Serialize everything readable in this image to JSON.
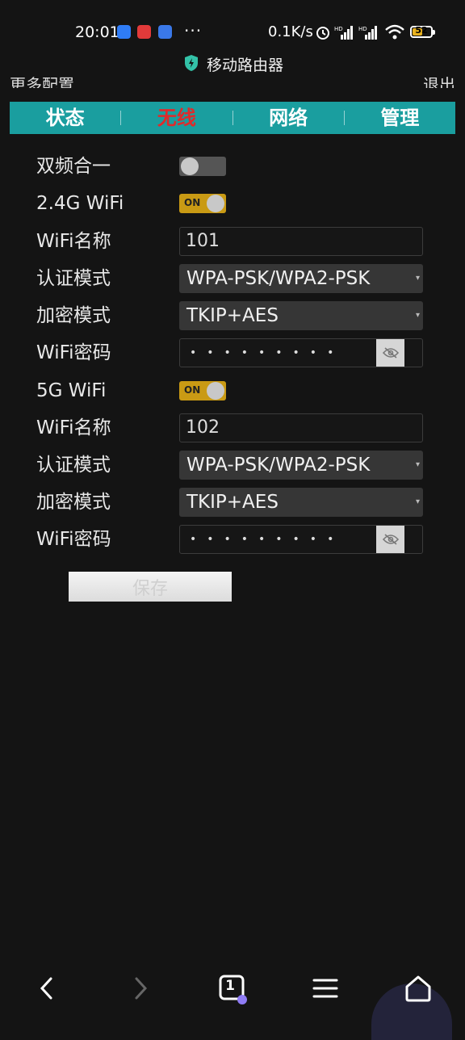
{
  "status_bar": {
    "time": "20:01",
    "dots": "···",
    "speed": "0.1K/s",
    "battery": "52",
    "icons": [
      "app-icon",
      "app-icon",
      "app-icon",
      "alarm-icon",
      "hd-signal-icon",
      "hd-signal-icon",
      "wifi-icon",
      "battery-icon"
    ]
  },
  "title": "移动路由器",
  "top_links": {
    "left": "更多配置",
    "right": "退出"
  },
  "tabs": [
    {
      "label": "状态",
      "active": false
    },
    {
      "label": "无线",
      "active": true
    },
    {
      "label": "网络",
      "active": false
    },
    {
      "label": "管理",
      "active": false
    }
  ],
  "form": {
    "dual_band": {
      "label": "双频合一",
      "state": "off"
    },
    "wifi24": {
      "label": "2.4G WiFi",
      "state": "on",
      "on_text": "ON",
      "ssid_label": "WiFi名称",
      "ssid": "101",
      "auth_label": "认证模式",
      "auth": "WPA-PSK/WPA2-PSK",
      "enc_label": "加密模式",
      "enc": "TKIP+AES",
      "pwd_label": "WiFi密码",
      "pwd_mask": "•••••••••"
    },
    "wifi5": {
      "label": "5G WiFi",
      "state": "on",
      "on_text": "ON",
      "ssid_label": "WiFi名称",
      "ssid": "102",
      "auth_label": "认证模式",
      "auth": "WPA-PSK/WPA2-PSK",
      "enc_label": "加密模式",
      "enc": "TKIP+AES",
      "pwd_label": "WiFi密码",
      "pwd_mask": "•••••••••"
    },
    "save_label": "保存"
  },
  "bottom_nav": {
    "tab_count": "1",
    "icons": [
      "back-icon",
      "forward-icon",
      "tabs-icon",
      "menu-icon",
      "home-icon"
    ]
  },
  "colors": {
    "nav_bg": "#1a9e9f",
    "active_tab": "#e02a2a",
    "toggle_on": "#c99a14"
  }
}
